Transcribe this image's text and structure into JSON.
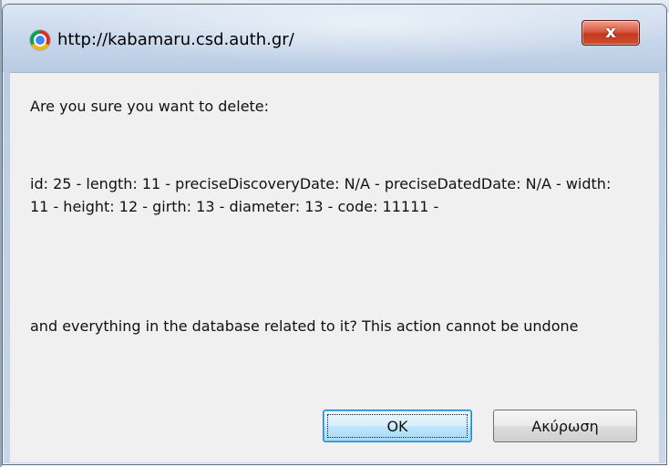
{
  "window": {
    "title": "http://kabamaru.csd.auth.gr/",
    "app_icon": "chrome-icon",
    "close_glyph": "x",
    "close_icon": "close-icon"
  },
  "message": {
    "intro": "Are you sure you want to delete:",
    "details": "id: 25 - length: 11 - preciseDiscoveryDate: N/A - preciseDatedDate: N/A - width: 11 - height: 12 - girth: 13 - diameter: 13 - code: 11111 -",
    "outro": "and everything in the database related to it? This action cannot be undone"
  },
  "buttons": {
    "ok_label": "OK",
    "cancel_label": "Ακύρωση"
  },
  "colors": {
    "titlebar": "#c6d6ea",
    "content_bg": "#f0f0f0",
    "close_button": "#c2391f",
    "ok_focus_border": "#3c7fb1"
  }
}
